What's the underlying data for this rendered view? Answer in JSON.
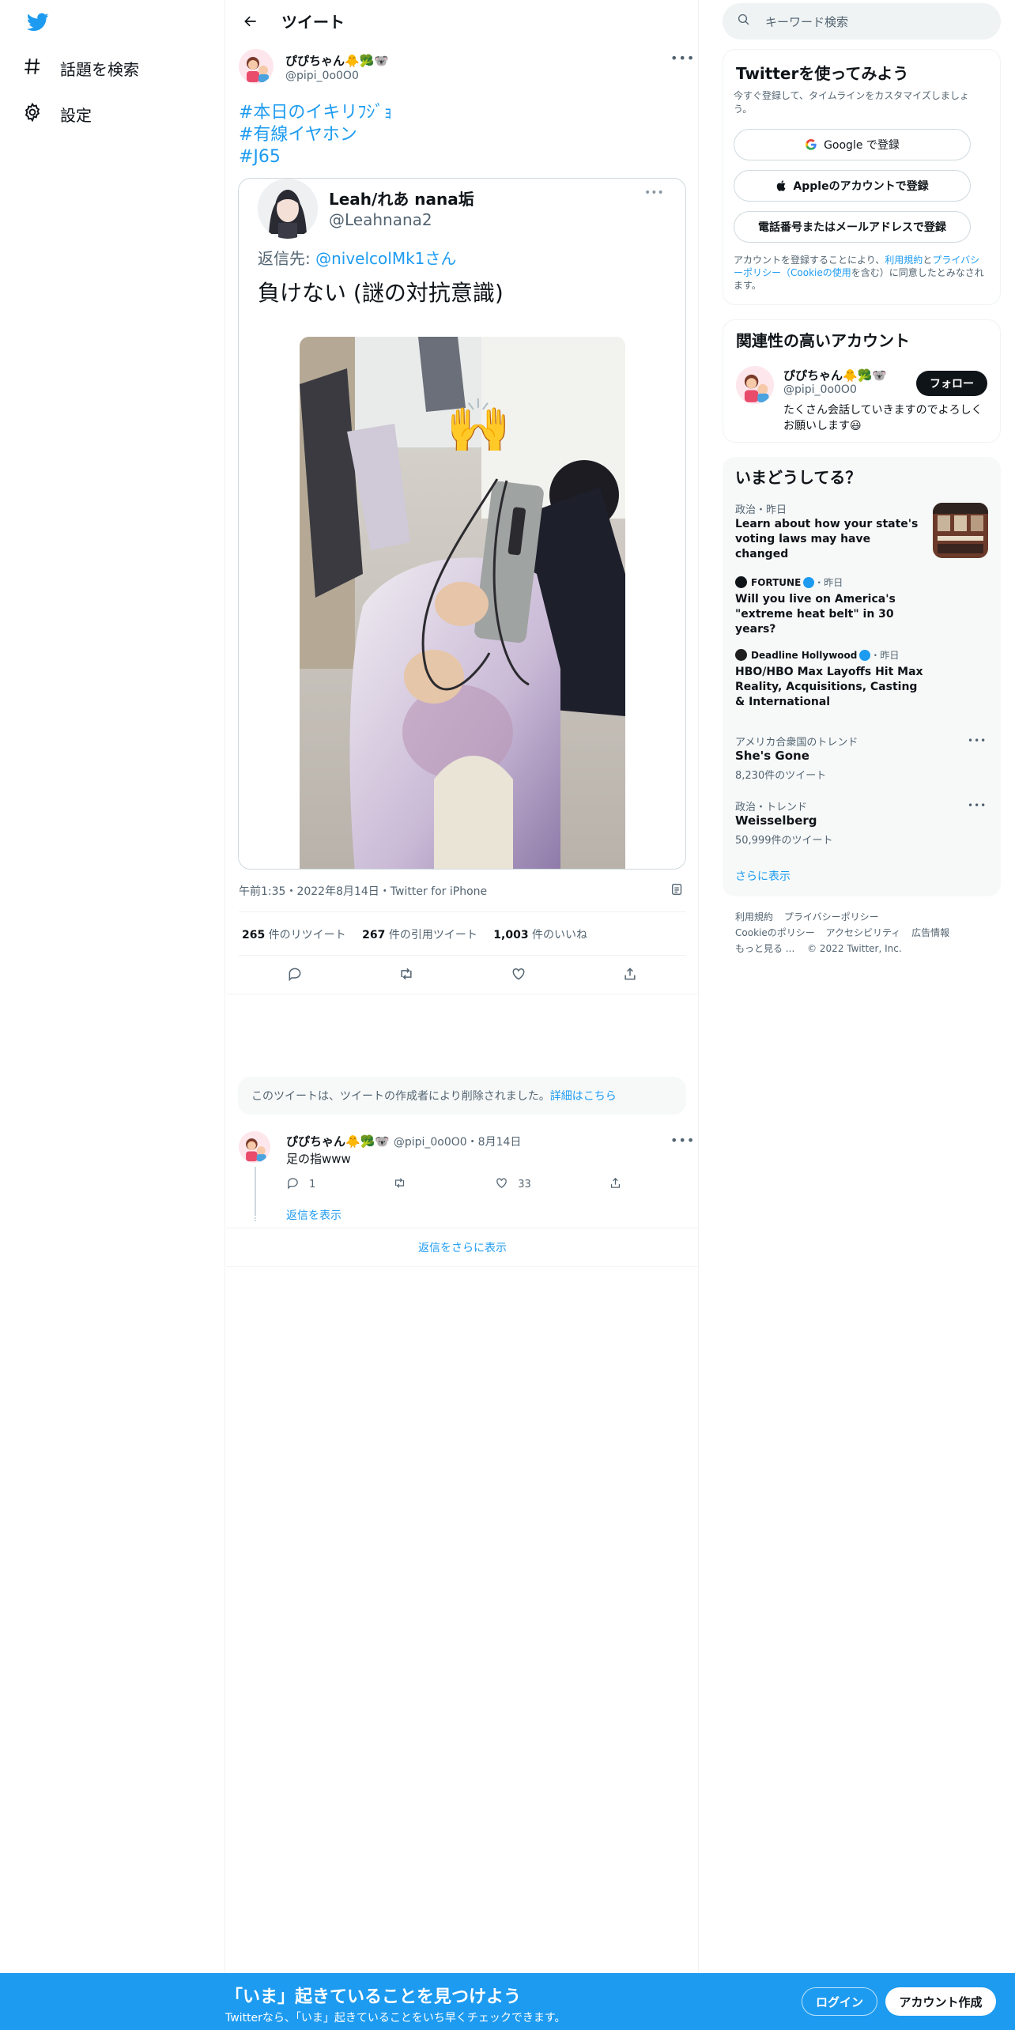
{
  "nav": {
    "explore_label": "話題を検索",
    "settings_label": "設定"
  },
  "header": {
    "title": "ツイート"
  },
  "tweet": {
    "author_name": "ぴぴちゃん🐥🥦🐨",
    "author_handle": "@pipi_0o0O0",
    "hashtags": [
      "#本日のイキリﾌｼﾞｮ",
      "#有線イヤホン",
      "#J65"
    ],
    "quote": {
      "author_name": "Leah/れあ nana垢",
      "author_handle": "@Leahnana2",
      "reply_prefix": "返信先: ",
      "reply_to": "@nivelcolMk1さん",
      "text": "負けない (謎の対抗意識)"
    },
    "timestamp": "午前1:35・2022年8月14日・Twitter for iPhone",
    "stats": {
      "retweets_count": "265",
      "retweets_label": " 件のリツイート",
      "quotes_count": "267",
      "quotes_label": " 件の引用ツイート",
      "likes_count": "1,003",
      "likes_label": " 件のいいね"
    }
  },
  "deleted_notice": {
    "text": "このツイートは、ツイートの作成者により削除されました。",
    "link": "詳細はこちら"
  },
  "reply": {
    "author_name": "ぴぴちゃん🐥🥦🐨",
    "meta": "@pipi_0o0O0・8月14日",
    "text": "足の指www",
    "reply_count": "1",
    "like_count": "33",
    "show_replies": "返信を表示"
  },
  "more_replies": "返信をさらに表示",
  "right": {
    "search_placeholder": "キーワード検索",
    "signup": {
      "title": "Twitterを使ってみよう",
      "subtitle": "今すぐ登録して、タイムラインをカスタマイズしましょう。",
      "google": "Google で登録",
      "apple": "Appleのアカウントで登録",
      "phone": "電話番号またはメールアドレスで登録",
      "terms_pre": "アカウントを登録することにより、",
      "terms_link1": "利用規約",
      "terms_mid": "と",
      "terms_link2": "プライバシーポリシー（Cookieの使用",
      "terms_post": "を含む）に同意したとみなされます。"
    },
    "relevant": {
      "title": "関連性の高いアカウント",
      "name": "ぴぴちゃん🐥🥦🐨",
      "handle": "@pipi_0o0O0",
      "follow": "フォロー",
      "bio": "たくさん会話していきますのでよろしくお願いします😃"
    },
    "trends": {
      "title": "いまどうしてる？",
      "items": [
        {
          "category": "政治・昨日",
          "title": "Learn about how your state's voting laws may have changed"
        },
        {
          "source": "FORTUNE",
          "time": "・昨日",
          "title": "Will you live on America's \"extreme heat belt\" in 30 years?"
        },
        {
          "source": "Deadline Hollywood",
          "time": "・昨日",
          "title": "HBO/HBO Max Layoffs Hit Max Reality, Acquisitions, Casting & International"
        },
        {
          "category": "アメリカ合衆国のトレンド",
          "title": "She's Gone",
          "count": "8,230件のツイート"
        },
        {
          "category": "政治・トレンド",
          "title": "Weisselberg",
          "count": "50,999件のツイート"
        }
      ],
      "show_more": "さらに表示"
    },
    "footer": {
      "l1": "利用規約",
      "l2": "プライバシーポリシー",
      "l3": "Cookieのポリシー",
      "l4": "アクセシビリティ",
      "l5": "広告情報",
      "l6": "もっと見る ...",
      "copyright": "© 2022 Twitter, Inc."
    }
  },
  "bottom_bar": {
    "headline": "「いま」起きていることを見つけよう",
    "sub": "Twitterなら、「いま」起きていることをいち早くチェックできます。",
    "login": "ログイン",
    "signup": "アカウント作成"
  },
  "colors": {
    "accent": "#1d9bf0",
    "text": "#0f1419",
    "muted": "#536471"
  }
}
